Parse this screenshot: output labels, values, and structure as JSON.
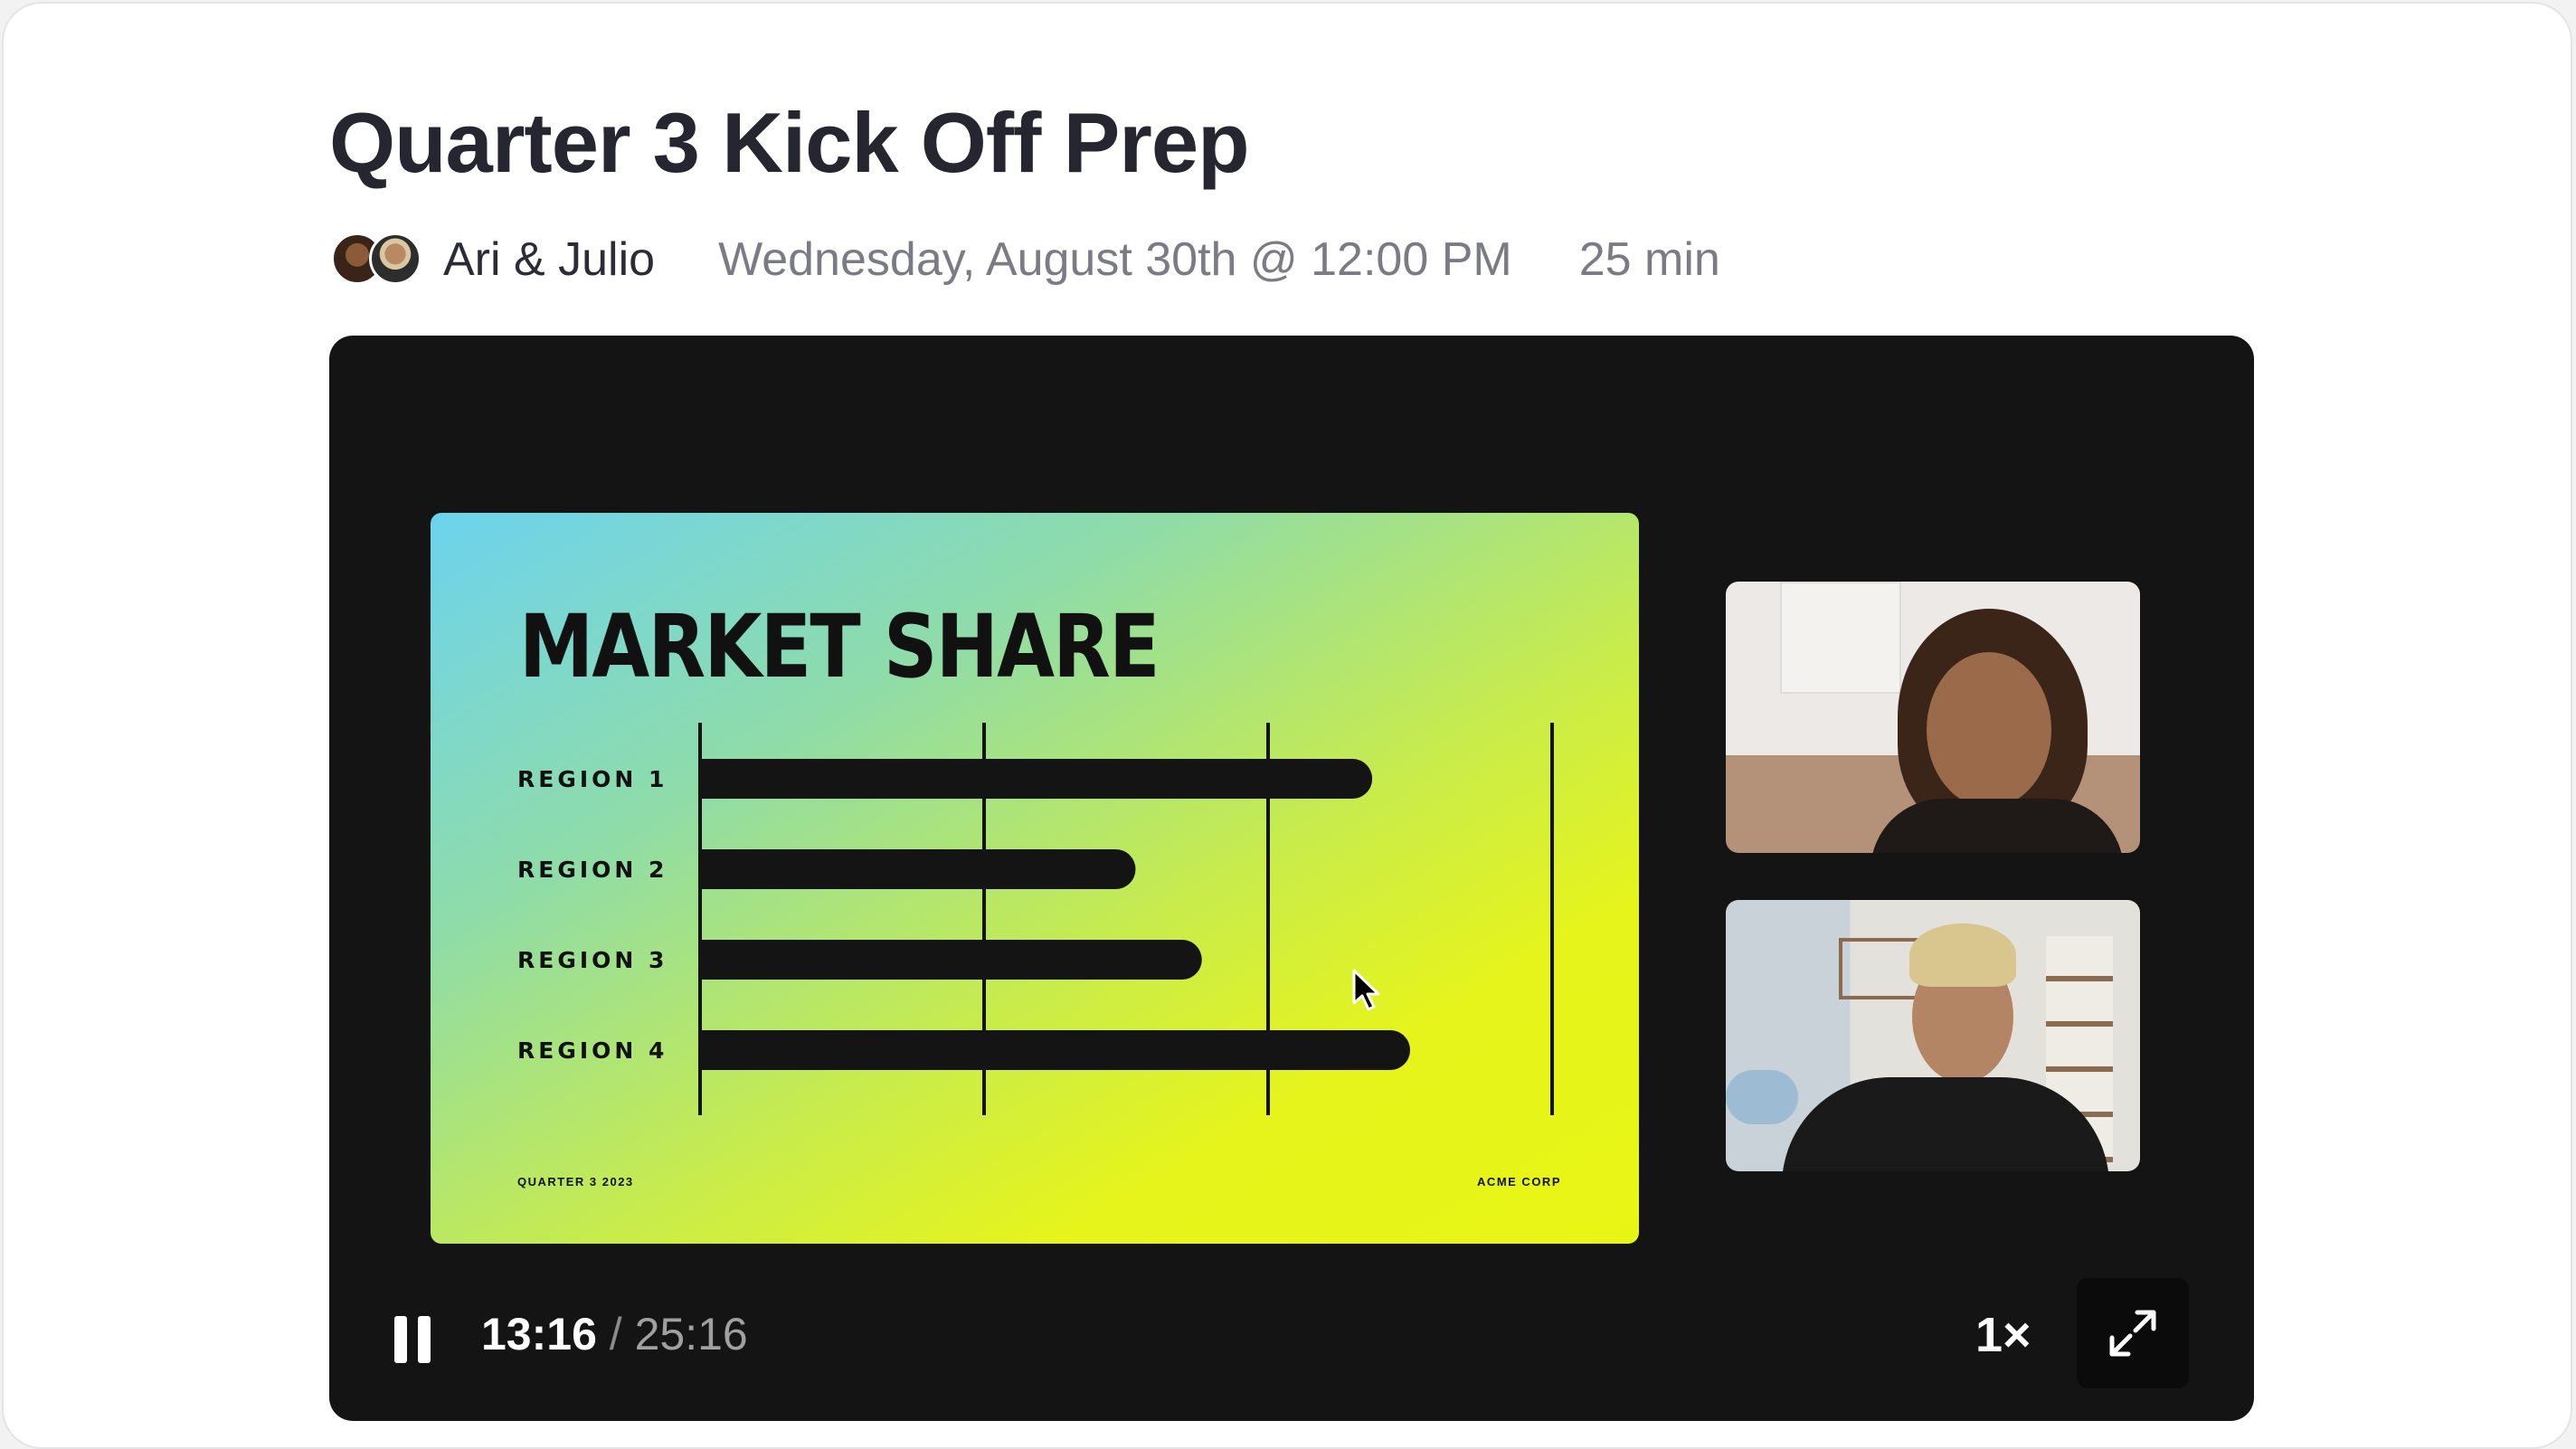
{
  "meeting": {
    "title": "Quarter 3 Kick Off Prep",
    "hosts": "Ari & Julio",
    "datetime": "Wednesday, August 30th @ 12:00 PM",
    "duration": "25 min"
  },
  "slide": {
    "title": "MARKET SHARE",
    "footer_left": "QUARTER 3 2023",
    "footer_right": "ACME CORP"
  },
  "chart_data": {
    "type": "bar",
    "orientation": "horizontal",
    "title": "MARKET SHARE",
    "categories": [
      "REGION 1",
      "REGION 2",
      "REGION 3",
      "REGION 4"
    ],
    "values": [
      71,
      46,
      53,
      75
    ],
    "xlim": [
      0,
      90
    ],
    "grid": true,
    "gridlines": [
      0,
      30,
      60,
      90
    ],
    "colors": {
      "bar": "#141414",
      "grid": "#141414"
    }
  },
  "player": {
    "current_time": "13:16",
    "separator": "/",
    "total_time": "25:16",
    "speed": "1×",
    "icons": {
      "pause": "pause-icon",
      "fullscreen": "expand-icon",
      "cursor": "mouse-pointer-icon"
    }
  },
  "colors": {
    "title": "#262630",
    "muted": "#7b7b85",
    "player_bg": "#141414",
    "slide_gradient_start": "#6cd3ee",
    "slide_gradient_end": "#e8f514"
  }
}
